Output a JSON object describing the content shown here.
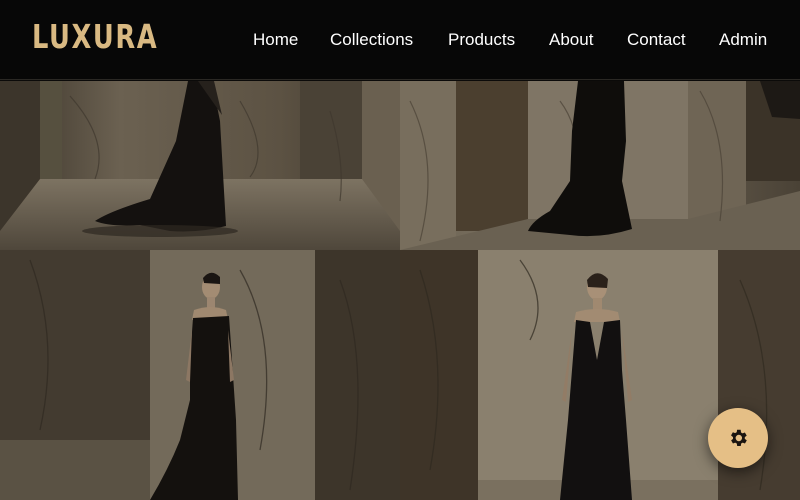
{
  "brand": {
    "name": "LUXURA",
    "color": "#d9b982"
  },
  "nav": {
    "items": [
      {
        "label": "Home"
      },
      {
        "label": "Collections"
      },
      {
        "label": "Products"
      },
      {
        "label": "About"
      },
      {
        "label": "Contact"
      },
      {
        "label": "Admin"
      }
    ]
  },
  "gallery": {
    "items": [
      {
        "name": "gown-photo-top-left",
        "content": "black velvet gown with train, marble room"
      },
      {
        "name": "gown-photo-top-right",
        "content": "black velvet mermaid gown, marble room"
      },
      {
        "name": "gown-photo-bottom-left",
        "content": "model in strapless black satin gown"
      },
      {
        "name": "gown-photo-bottom-right",
        "content": "model in black satin plunge gown"
      }
    ]
  },
  "fab": {
    "icon": "gear-icon",
    "color": "#e5bf86"
  }
}
